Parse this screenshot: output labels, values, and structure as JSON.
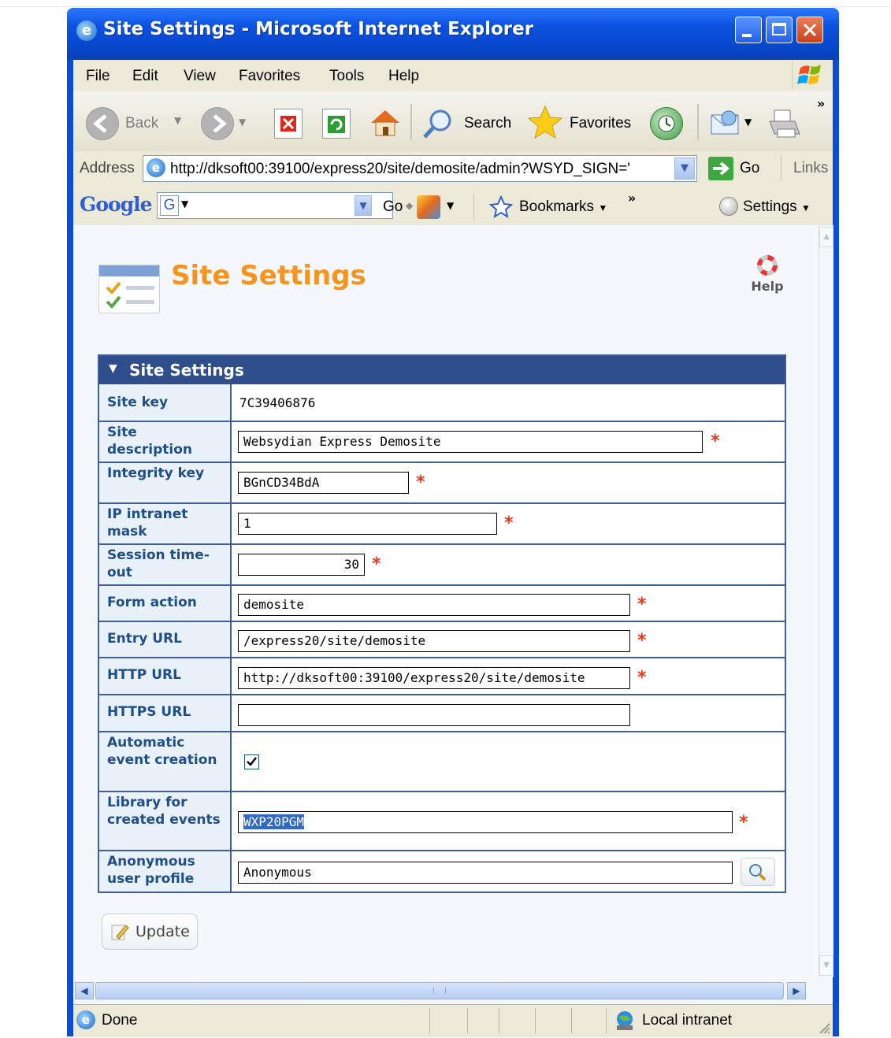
{
  "window": {
    "title": "Site Settings - Microsoft Internet Explorer"
  },
  "menu": [
    "File",
    "Edit",
    "View",
    "Favorites",
    "Tools",
    "Help"
  ],
  "toolbar": {
    "back": "Back",
    "search": "Search",
    "favorites": "Favorites"
  },
  "address": {
    "label": "Address",
    "url": "http://dksoft00:39100/express20/site/demosite/admin?WSYD_SIGN='",
    "go": "Go",
    "links": "Links"
  },
  "google_bar": {
    "logo": "Google",
    "go": "Go",
    "bookmarks": "Bookmarks",
    "settings": "Settings"
  },
  "page": {
    "title": "Site Settings",
    "help": "Help",
    "section_title": "Site Settings",
    "update_button": "Update"
  },
  "fields": {
    "site_key": {
      "label": "Site key",
      "value": "7C39406876"
    },
    "site_description": {
      "label": "Site description",
      "value": "Websydian Express Demosite"
    },
    "integrity_key": {
      "label": "Integrity key",
      "value": "BGnCD34BdA"
    },
    "ip_intranet_mask": {
      "label": "IP intranet mask",
      "value": "1"
    },
    "session_timeout": {
      "label": "Session time-out",
      "value": "30"
    },
    "form_action": {
      "label": "Form action",
      "value": "demosite"
    },
    "entry_url": {
      "label": "Entry URL",
      "value": "/express20/site/demosite"
    },
    "http_url": {
      "label": "HTTP URL",
      "value": "http://dksoft00:39100/express20/site/demosite"
    },
    "https_url": {
      "label": "HTTPS URL",
      "value": ""
    },
    "automatic_event_creation": {
      "label": "Automatic event creation",
      "checked": true
    },
    "library_for_created_events": {
      "label": "Library for created events",
      "value": "WXP20PGM"
    },
    "anonymous_user_profile": {
      "label": "Anonymous user profile",
      "value": "Anonymous"
    }
  },
  "status": {
    "text": "Done",
    "zone": "Local intranet"
  },
  "colors": {
    "title_orange": "#f7941d",
    "section_header": "#2f4f8c",
    "label_blue": "#1f4e88",
    "required_red": "#e6391a",
    "xp_blue": "#0a4dd8"
  }
}
